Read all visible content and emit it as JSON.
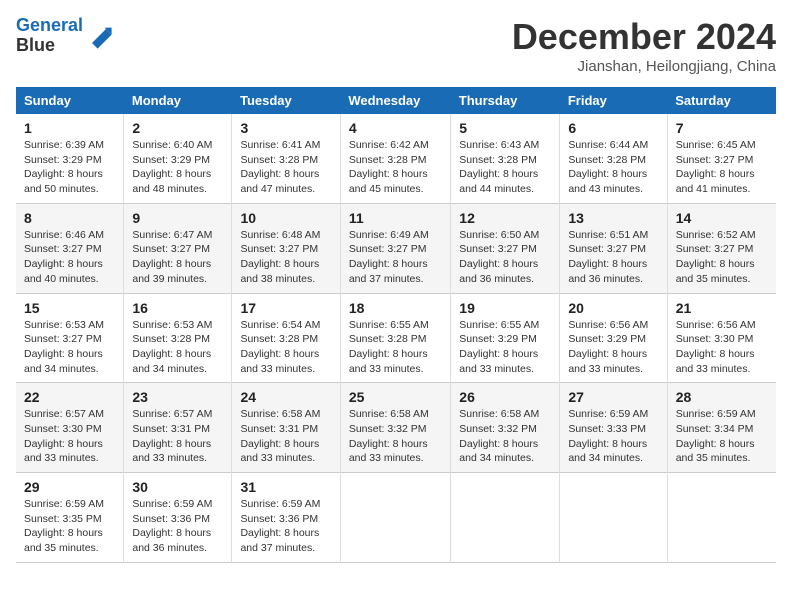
{
  "header": {
    "logo_line1": "General",
    "logo_line2": "Blue",
    "month": "December 2024",
    "location": "Jianshan, Heilongjiang, China"
  },
  "weekdays": [
    "Sunday",
    "Monday",
    "Tuesday",
    "Wednesday",
    "Thursday",
    "Friday",
    "Saturday"
  ],
  "weeks": [
    [
      {
        "day": "1",
        "sunrise": "6:39 AM",
        "sunset": "3:29 PM",
        "daylight": "8 hours and 50 minutes."
      },
      {
        "day": "2",
        "sunrise": "6:40 AM",
        "sunset": "3:29 PM",
        "daylight": "8 hours and 48 minutes."
      },
      {
        "day": "3",
        "sunrise": "6:41 AM",
        "sunset": "3:28 PM",
        "daylight": "8 hours and 47 minutes."
      },
      {
        "day": "4",
        "sunrise": "6:42 AM",
        "sunset": "3:28 PM",
        "daylight": "8 hours and 45 minutes."
      },
      {
        "day": "5",
        "sunrise": "6:43 AM",
        "sunset": "3:28 PM",
        "daylight": "8 hours and 44 minutes."
      },
      {
        "day": "6",
        "sunrise": "6:44 AM",
        "sunset": "3:28 PM",
        "daylight": "8 hours and 43 minutes."
      },
      {
        "day": "7",
        "sunrise": "6:45 AM",
        "sunset": "3:27 PM",
        "daylight": "8 hours and 41 minutes."
      }
    ],
    [
      {
        "day": "8",
        "sunrise": "6:46 AM",
        "sunset": "3:27 PM",
        "daylight": "8 hours and 40 minutes."
      },
      {
        "day": "9",
        "sunrise": "6:47 AM",
        "sunset": "3:27 PM",
        "daylight": "8 hours and 39 minutes."
      },
      {
        "day": "10",
        "sunrise": "6:48 AM",
        "sunset": "3:27 PM",
        "daylight": "8 hours and 38 minutes."
      },
      {
        "day": "11",
        "sunrise": "6:49 AM",
        "sunset": "3:27 PM",
        "daylight": "8 hours and 37 minutes."
      },
      {
        "day": "12",
        "sunrise": "6:50 AM",
        "sunset": "3:27 PM",
        "daylight": "8 hours and 36 minutes."
      },
      {
        "day": "13",
        "sunrise": "6:51 AM",
        "sunset": "3:27 PM",
        "daylight": "8 hours and 36 minutes."
      },
      {
        "day": "14",
        "sunrise": "6:52 AM",
        "sunset": "3:27 PM",
        "daylight": "8 hours and 35 minutes."
      }
    ],
    [
      {
        "day": "15",
        "sunrise": "6:53 AM",
        "sunset": "3:27 PM",
        "daylight": "8 hours and 34 minutes."
      },
      {
        "day": "16",
        "sunrise": "6:53 AM",
        "sunset": "3:28 PM",
        "daylight": "8 hours and 34 minutes."
      },
      {
        "day": "17",
        "sunrise": "6:54 AM",
        "sunset": "3:28 PM",
        "daylight": "8 hours and 33 minutes."
      },
      {
        "day": "18",
        "sunrise": "6:55 AM",
        "sunset": "3:28 PM",
        "daylight": "8 hours and 33 minutes."
      },
      {
        "day": "19",
        "sunrise": "6:55 AM",
        "sunset": "3:29 PM",
        "daylight": "8 hours and 33 minutes."
      },
      {
        "day": "20",
        "sunrise": "6:56 AM",
        "sunset": "3:29 PM",
        "daylight": "8 hours and 33 minutes."
      },
      {
        "day": "21",
        "sunrise": "6:56 AM",
        "sunset": "3:30 PM",
        "daylight": "8 hours and 33 minutes."
      }
    ],
    [
      {
        "day": "22",
        "sunrise": "6:57 AM",
        "sunset": "3:30 PM",
        "daylight": "8 hours and 33 minutes."
      },
      {
        "day": "23",
        "sunrise": "6:57 AM",
        "sunset": "3:31 PM",
        "daylight": "8 hours and 33 minutes."
      },
      {
        "day": "24",
        "sunrise": "6:58 AM",
        "sunset": "3:31 PM",
        "daylight": "8 hours and 33 minutes."
      },
      {
        "day": "25",
        "sunrise": "6:58 AM",
        "sunset": "3:32 PM",
        "daylight": "8 hours and 33 minutes."
      },
      {
        "day": "26",
        "sunrise": "6:58 AM",
        "sunset": "3:32 PM",
        "daylight": "8 hours and 34 minutes."
      },
      {
        "day": "27",
        "sunrise": "6:59 AM",
        "sunset": "3:33 PM",
        "daylight": "8 hours and 34 minutes."
      },
      {
        "day": "28",
        "sunrise": "6:59 AM",
        "sunset": "3:34 PM",
        "daylight": "8 hours and 35 minutes."
      }
    ],
    [
      {
        "day": "29",
        "sunrise": "6:59 AM",
        "sunset": "3:35 PM",
        "daylight": "8 hours and 35 minutes."
      },
      {
        "day": "30",
        "sunrise": "6:59 AM",
        "sunset": "3:36 PM",
        "daylight": "8 hours and 36 minutes."
      },
      {
        "day": "31",
        "sunrise": "6:59 AM",
        "sunset": "3:36 PM",
        "daylight": "8 hours and 37 minutes."
      },
      null,
      null,
      null,
      null
    ]
  ]
}
